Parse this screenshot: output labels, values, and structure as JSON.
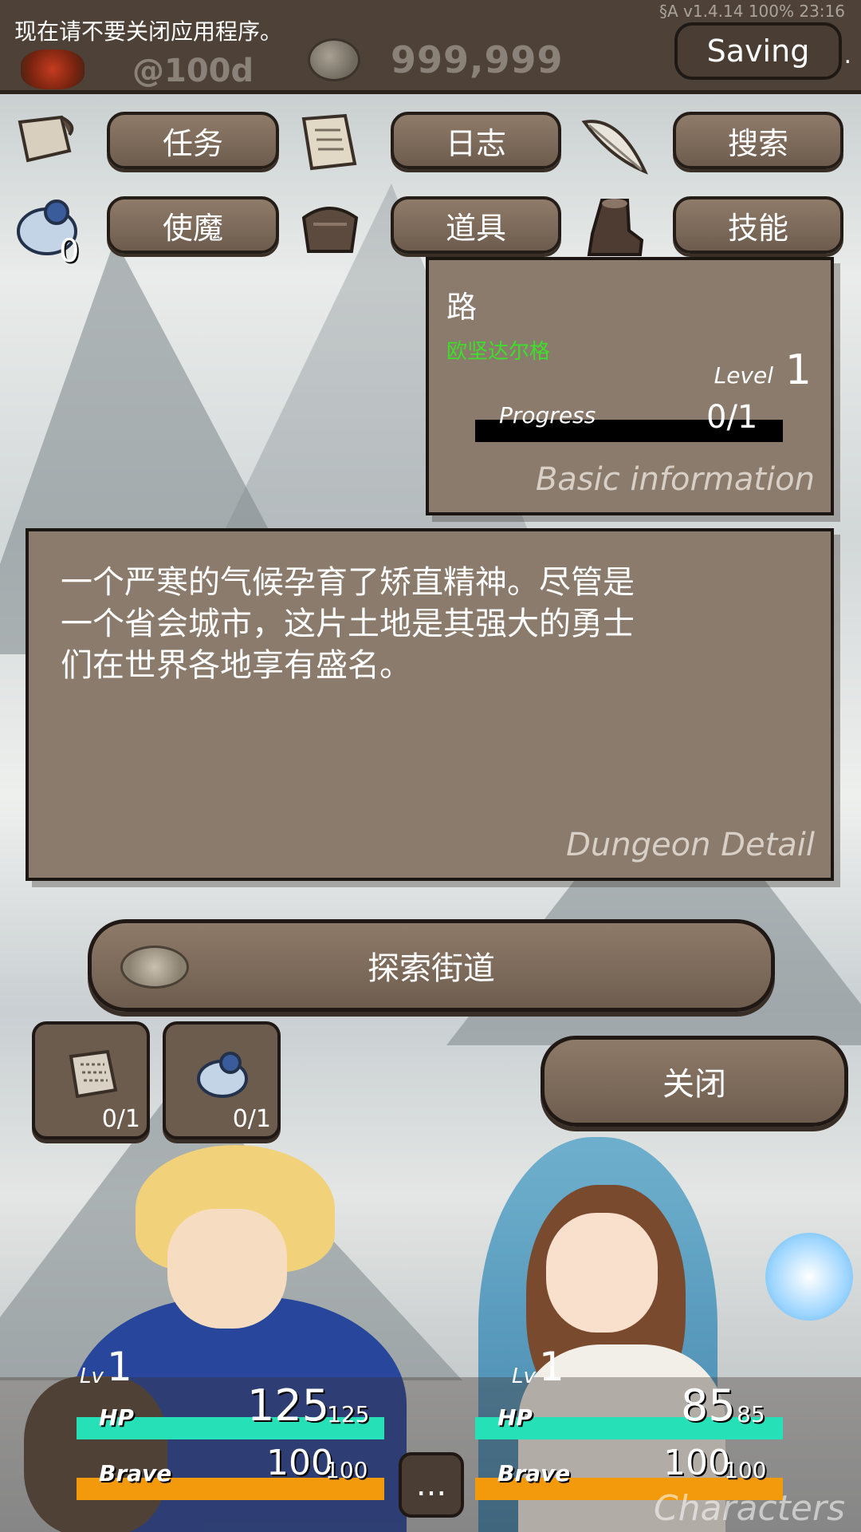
{
  "status": {
    "notice": "现在请不要关闭应用程序。",
    "version_info": "§A v1.4.14 100% 23:16",
    "days": "@100d",
    "gold": "999,999",
    "saving_label": "Saving",
    "saving_suffix": "."
  },
  "menu": {
    "row1": [
      {
        "icon": "scroll-icon",
        "label": "任务"
      },
      {
        "icon": "parchment-icon",
        "label": "日志"
      },
      {
        "icon": "feather-icon",
        "label": "搜索"
      }
    ],
    "row2": [
      {
        "icon": "familiar-icon",
        "label": "使魔",
        "badge": "0"
      },
      {
        "icon": "bag-icon",
        "label": "道具"
      },
      {
        "icon": "boot-icon",
        "label": "技能"
      }
    ]
  },
  "basic_info": {
    "title": "路",
    "location": "欧坚达尔格",
    "level_label": "Level",
    "level": "1",
    "progress_label": "Progress",
    "progress_text": "0/1",
    "progress_fraction": 0,
    "footer": "Basic information"
  },
  "dungeon_detail": {
    "description": "一个严寒的气候孕育了矫直精神。尽管是一个省会城市，这片土地是其强大的勇士们在世界各地享有盛名。",
    "footer": "Dungeon Detail"
  },
  "explore": {
    "label": "探索街道"
  },
  "slots": [
    {
      "icon": "map-icon",
      "count": "0/1"
    },
    {
      "icon": "familiar-icon",
      "count": "0/1"
    }
  ],
  "close": {
    "label": "关闭"
  },
  "characters": [
    {
      "lv_label": "Lv",
      "lv": "1",
      "hp_label": "HP",
      "hp": "125",
      "hp_max": "125",
      "brave_label": "Brave",
      "brave": "100",
      "brave_max": "100"
    },
    {
      "lv_label": "Lv",
      "lv": "1",
      "hp_label": "HP",
      "hp": "85",
      "hp_max": "85",
      "brave_label": "Brave",
      "brave": "100",
      "brave_max": "100"
    }
  ],
  "more_label": "...",
  "characters_label": "Characters",
  "colors": {
    "panel": "#8a7b6c",
    "hp": "#26e0b8",
    "brave": "#f2990c",
    "location": "#3ddf2a"
  }
}
